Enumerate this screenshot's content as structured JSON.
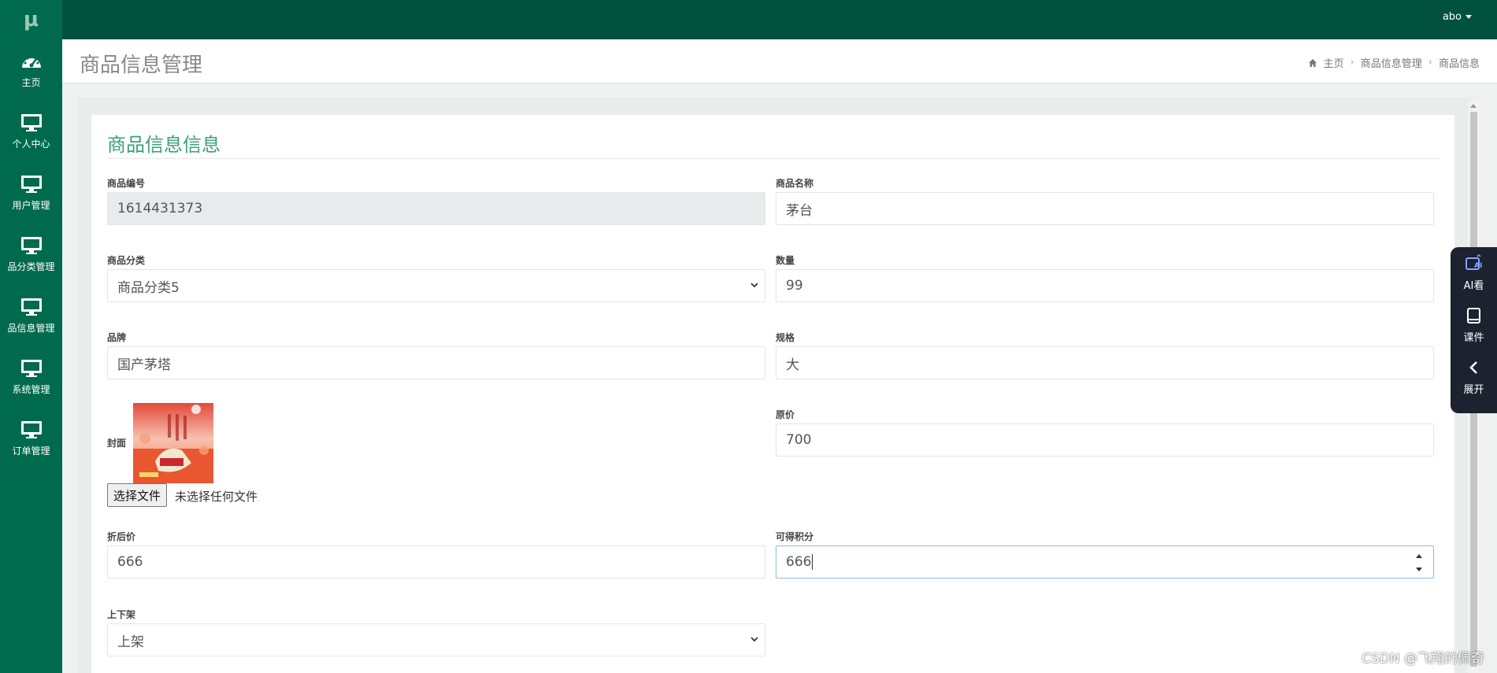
{
  "app": {
    "logo": "μ",
    "user": "abo"
  },
  "sidebar": {
    "items": [
      {
        "label": "主页",
        "icon": "dashboard-icon"
      },
      {
        "label": "个人中心",
        "icon": "monitor-icon"
      },
      {
        "label": "用户管理",
        "icon": "monitor-icon"
      },
      {
        "label": "品分类管理",
        "icon": "monitor-icon"
      },
      {
        "label": "品信息管理",
        "icon": "monitor-icon"
      },
      {
        "label": "系统管理",
        "icon": "monitor-icon"
      },
      {
        "label": "订单管理",
        "icon": "monitor-icon"
      }
    ]
  },
  "header": {
    "title": "商品信息管理",
    "breadcrumb": [
      "主页",
      "商品信息管理",
      "商品信息"
    ]
  },
  "form": {
    "title": "商品信息信息",
    "fields": {
      "product_no": {
        "label": "商品编号",
        "value": "1614431373"
      },
      "product_name": {
        "label": "商品名称",
        "value": "茅台"
      },
      "category": {
        "label": "商品分类",
        "value": "商品分类5"
      },
      "quantity": {
        "label": "数量",
        "value": "99"
      },
      "brand": {
        "label": "品牌",
        "value": "国产茅塔"
      },
      "spec": {
        "label": "规格",
        "value": "大"
      },
      "cover": {
        "label": "封面",
        "button": "选择文件",
        "status": "未选择任何文件"
      },
      "original_price": {
        "label": "原价",
        "value": "700"
      },
      "discount_price": {
        "label": "折后价",
        "value": "666"
      },
      "points": {
        "label": "可得积分",
        "value": "666"
      },
      "shelf_status": {
        "label": "上下架",
        "value": "上架"
      }
    }
  },
  "float_panel": {
    "items": [
      {
        "label": "AI看",
        "icon": "ai-view-icon"
      },
      {
        "label": "课件",
        "icon": "courseware-icon"
      },
      {
        "label": "展开",
        "icon": "chevron-left-icon"
      }
    ]
  },
  "watermark": "CSDN @飞翔的佩奇",
  "colors": {
    "sidebar": "#006a4e",
    "topbar": "#00513d",
    "accent": "#3aa07a",
    "panel": "#1d2230"
  }
}
